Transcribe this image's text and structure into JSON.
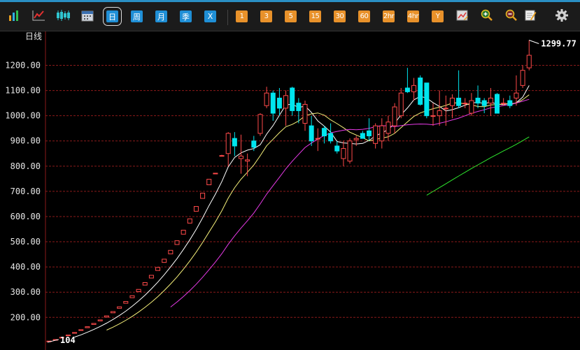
{
  "toolbar": {
    "icons": [
      {
        "name": "bar-chart-icon",
        "color": "#e8a020"
      },
      {
        "name": "line-chart-icon",
        "color": "#e23030"
      },
      {
        "name": "candlestick-icon",
        "color": "#2fc5d0"
      },
      {
        "name": "calendar-icon",
        "color": "#cfd6e0"
      }
    ],
    "periods_blue": [
      {
        "label": "日",
        "selected": true
      },
      {
        "label": "周",
        "selected": false
      },
      {
        "label": "月",
        "selected": false
      },
      {
        "label": "季",
        "selected": false
      },
      {
        "label": "X",
        "selected": false
      }
    ],
    "periods_orange": [
      "1",
      "3",
      "5",
      "15",
      "30",
      "60",
      "2hr",
      "4hr",
      "Y"
    ],
    "tools": [
      {
        "name": "draw-tool-icon"
      },
      {
        "name": "zoom-in-icon"
      },
      {
        "name": "zoom-out-icon"
      },
      {
        "name": "edit-note-icon"
      },
      {
        "name": "settings-gear-icon"
      }
    ]
  },
  "chart": {
    "title": "日线",
    "high_annotation": "1299.77",
    "low_annotation": "104"
  },
  "chart_data": {
    "type": "candlestick",
    "y_ticks": [
      "1200.00",
      "1100.00",
      "1000.00",
      "900.00",
      "800.00",
      "700.00",
      "600.00",
      "500.00",
      "400.00",
      "300.00",
      "200.00"
    ],
    "ylim": [
      104,
      1300
    ],
    "grid": true,
    "colors": {
      "up": "#ff4a4a",
      "down": "#00e5ee",
      "grid": "#8b1a1a",
      "ma5": "#ffffff",
      "ma10": "#f6f07a",
      "ma20": "#e83ae8",
      "ma60": "#2ee82e"
    },
    "candles": [
      [
        104,
        106,
        104,
        106
      ],
      [
        110,
        112,
        110,
        112
      ],
      [
        118,
        121,
        118,
        121
      ],
      [
        127,
        130,
        127,
        130
      ],
      [
        137,
        140,
        137,
        140
      ],
      [
        148,
        151,
        148,
        151
      ],
      [
        159,
        163,
        159,
        163
      ],
      [
        172,
        176,
        172,
        176
      ],
      [
        186,
        190,
        186,
        190
      ],
      [
        201,
        206,
        201,
        206
      ],
      [
        218,
        223,
        218,
        223
      ],
      [
        236,
        242,
        236,
        242
      ],
      [
        256,
        263,
        256,
        263
      ],
      [
        278,
        286,
        278,
        286
      ],
      [
        302,
        311,
        302,
        311
      ],
      [
        328,
        338,
        328,
        338
      ],
      [
        356,
        367,
        356,
        367
      ],
      [
        386,
        398,
        386,
        398
      ],
      [
        418,
        431,
        418,
        431
      ],
      [
        452,
        466,
        452,
        466
      ],
      [
        489,
        504,
        489,
        504
      ],
      [
        530,
        546,
        530,
        546
      ],
      [
        574,
        591,
        574,
        591
      ],
      [
        621,
        640,
        621,
        640
      ],
      [
        672,
        693,
        672,
        693
      ],
      [
        726,
        748,
        726,
        748
      ],
      [
        772,
        772,
        772,
        772
      ],
      [
        842,
        845,
        840,
        842
      ],
      [
        850,
        935,
        800,
        930
      ],
      [
        910,
        935,
        840,
        880
      ],
      [
        830,
        925,
        770,
        840
      ],
      [
        820,
        850,
        760,
        825
      ],
      [
        900,
        920,
        860,
        875
      ],
      [
        930,
        1010,
        920,
        1005
      ],
      [
        1040,
        1115,
        1030,
        1090
      ],
      [
        1090,
        1100,
        980,
        1010
      ],
      [
        1070,
        1110,
        1000,
        1030
      ],
      [
        1030,
        1100,
        960,
        1080
      ],
      [
        1110,
        1115,
        1000,
        1020
      ],
      [
        1050,
        1070,
        970,
        1020
      ],
      [
        970,
        1060,
        940,
        1045
      ],
      [
        960,
        1000,
        880,
        900
      ],
      [
        910,
        950,
        860,
        910
      ],
      [
        950,
        960,
        890,
        920
      ],
      [
        930,
        970,
        890,
        900
      ],
      [
        880,
        900,
        850,
        860
      ],
      [
        830,
        900,
        800,
        870
      ],
      [
        820,
        910,
        810,
        900
      ],
      [
        905,
        920,
        880,
        910
      ],
      [
        930,
        940,
        910,
        910
      ],
      [
        940,
        990,
        900,
        920
      ],
      [
        890,
        970,
        870,
        960
      ],
      [
        900,
        990,
        870,
        960
      ],
      [
        930,
        1000,
        900,
        975
      ],
      [
        960,
        1050,
        930,
        1035
      ],
      [
        1000,
        1110,
        990,
        1090
      ],
      [
        1110,
        1190,
        1090,
        1095
      ],
      [
        1095,
        1150,
        1060,
        1120
      ],
      [
        1150,
        1160,
        1040,
        1045
      ],
      [
        1130,
        1130,
        990,
        1000
      ],
      [
        1000,
        1050,
        960,
        1000
      ],
      [
        1000,
        1100,
        960,
        1020
      ],
      [
        1030,
        1080,
        960,
        1030
      ],
      [
        1040,
        1085,
        990,
        1070
      ],
      [
        1070,
        1180,
        1030,
        1040
      ],
      [
        1050,
        1070,
        1030,
        1050
      ],
      [
        1010,
        1090,
        1000,
        1060
      ],
      [
        1070,
        1120,
        1030,
        1050
      ],
      [
        1060,
        1070,
        1010,
        1040
      ],
      [
        1050,
        1110,
        1000,
        1070
      ],
      [
        1085,
        1090,
        1010,
        1010
      ],
      [
        1050,
        1070,
        1040,
        1050
      ],
      [
        1060,
        1080,
        1030,
        1040
      ],
      [
        1070,
        1160,
        1040,
        1090
      ],
      [
        1120,
        1200,
        1110,
        1180
      ],
      [
        1190,
        1299.77,
        1180,
        1240
      ]
    ]
  }
}
